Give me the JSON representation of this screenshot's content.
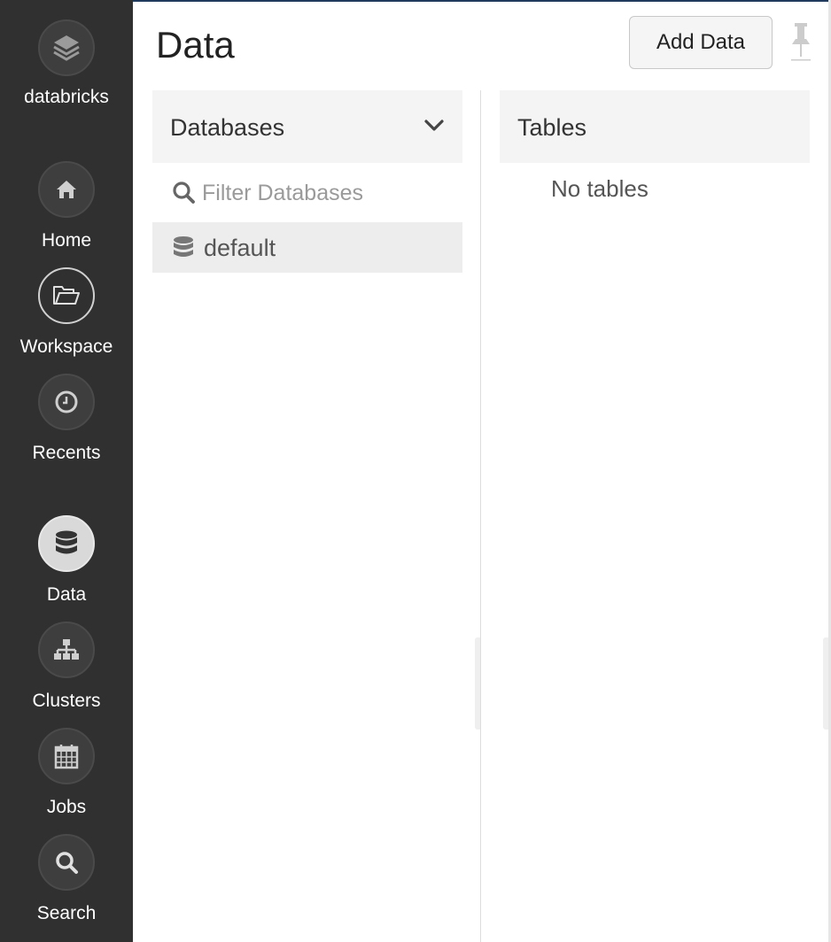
{
  "sidebar": {
    "logo": {
      "label": "databricks",
      "icon": "layers-icon"
    },
    "items": [
      {
        "label": "Home",
        "icon": "home-icon"
      },
      {
        "label": "Workspace",
        "icon": "folder-open-icon"
      },
      {
        "label": "Recents",
        "icon": "clock-icon"
      },
      {
        "label": "Data",
        "icon": "database-icon",
        "active": true
      },
      {
        "label": "Clusters",
        "icon": "cluster-icon"
      },
      {
        "label": "Jobs",
        "icon": "calendar-icon"
      },
      {
        "label": "Search",
        "icon": "search-icon"
      }
    ]
  },
  "header": {
    "title": "Data",
    "add_data_label": "Add Data",
    "pin_icon": "pin-icon"
  },
  "databases": {
    "header": "Databases",
    "filter_placeholder": "Filter Databases",
    "items": [
      {
        "name": "default"
      }
    ]
  },
  "tables": {
    "header": "Tables",
    "empty_text": "No tables"
  },
  "colors": {
    "sidebar_bg": "#303030",
    "panel_header_bg": "#f4f4f4",
    "selected_row_bg": "#ededed",
    "top_border": "#1f3a5c"
  }
}
